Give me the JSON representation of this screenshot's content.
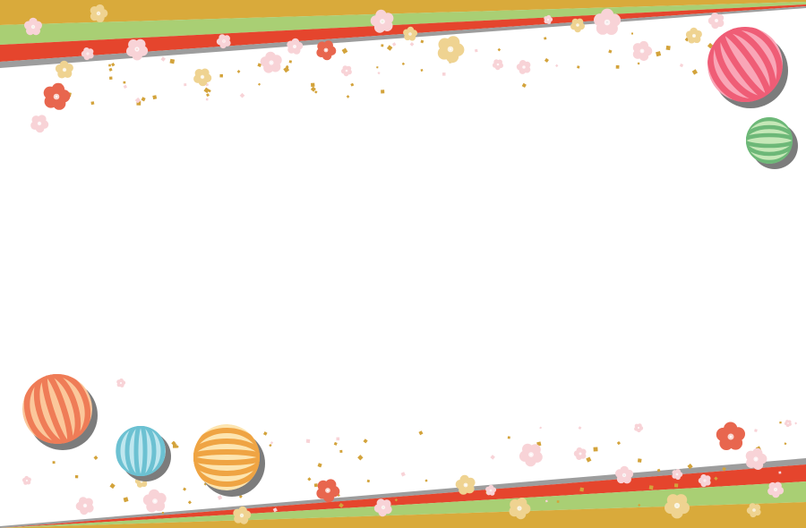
{
  "colors": {
    "background": "#ffffff",
    "gold": "#d9aa3b",
    "green": "#a9cf74",
    "red": "#e5452d",
    "grey": "#9d9d9d",
    "flower_pink": "#f8d3d7",
    "flower_coral": "#e8664e",
    "flower_yellow": "#efd391",
    "confetti": "#d3a33b"
  },
  "decorations": {
    "top_band": {
      "stripes": [
        "gold",
        "green",
        "red",
        "grey"
      ]
    },
    "bottom_band": {
      "stripes": [
        "grey",
        "red",
        "green",
        "gold"
      ]
    },
    "balls": [
      {
        "name": "pink-temari-ball",
        "stripe_color": "#ef5d76",
        "light_color": "#f9a6b7"
      },
      {
        "name": "green-temari-ball",
        "stripe_color": "#6db878",
        "light_color": "#c6e8b8"
      },
      {
        "name": "orange-temari-ball",
        "stripe_color": "#ef7c57",
        "light_color": "#fbc79b"
      },
      {
        "name": "blue-temari-ball",
        "stripe_color": "#6cc1d2",
        "light_color": "#bfe7ef"
      },
      {
        "name": "yellow-temari-ball",
        "stripe_color": "#efa443",
        "light_color": "#fde5b0"
      }
    ],
    "flower_icon": "plum-blossom-icon",
    "confetti_icon": "gold-confetti-icon"
  }
}
